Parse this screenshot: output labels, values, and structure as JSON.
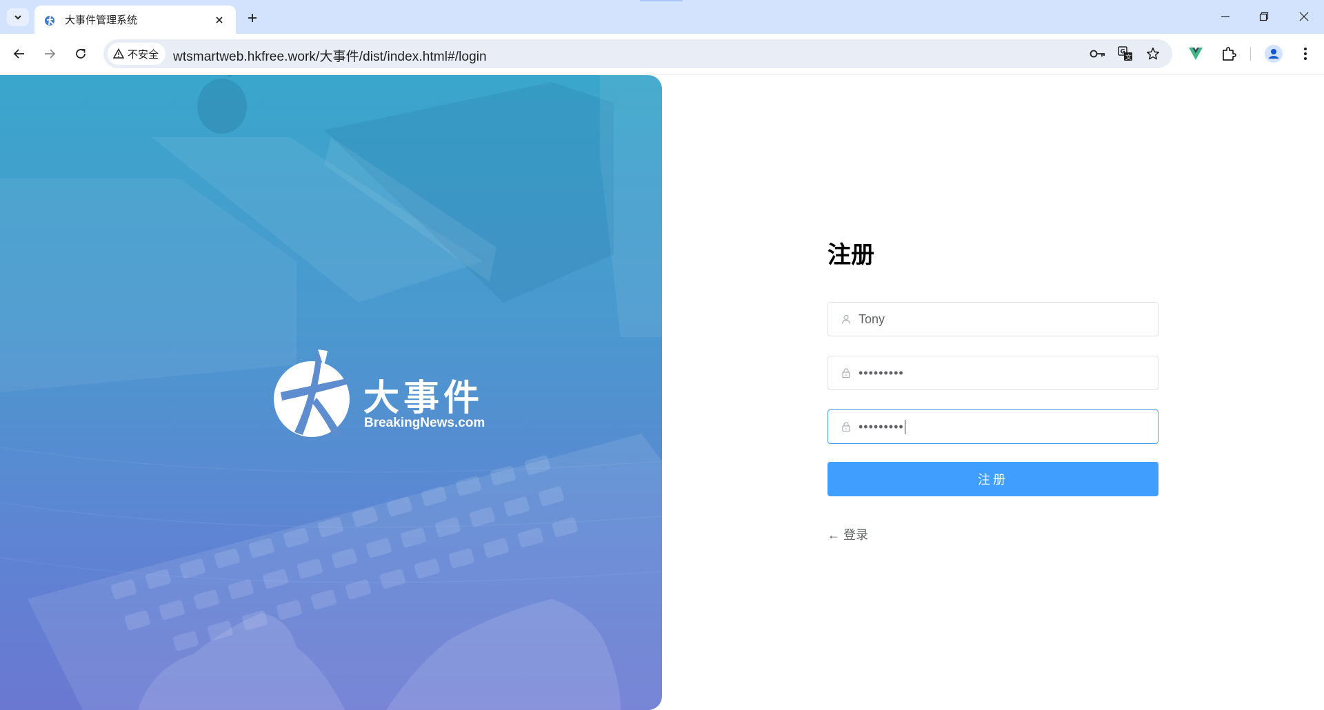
{
  "browser": {
    "tab_title": "大事件管理系统",
    "security_label": "不安全",
    "url": "wtsmartweb.hkfree.work/大事件/dist/index.html#/login"
  },
  "colors": {
    "primary": "#409eff",
    "hero_top": "#3aa6cb",
    "hero_bottom": "#6a78d2",
    "tabbar": "#d3e3fd"
  },
  "icons": {
    "tab_search": "chevron-down-icon",
    "favicon": "logo-icon",
    "close": "close-icon",
    "new_tab": "plus-icon",
    "back": "arrow-left-icon",
    "forward": "arrow-right-icon",
    "reload": "reload-icon",
    "warning": "warning-icon",
    "password_manager": "key-icon",
    "translate": "translate-icon",
    "bookmark": "star-icon",
    "vue_devtools": "vue-icon",
    "extensions": "puzzle-icon",
    "profile": "person-icon",
    "menu": "kebab-icon",
    "user": "user-icon",
    "lock": "lock-icon"
  },
  "brand": {
    "name": "大事件",
    "domain": "BreakingNews.com"
  },
  "register_form": {
    "title": "注册",
    "username_value": "Tony",
    "password_value": "•••••••••",
    "repassword_value": "•••••••••",
    "submit_label": "注册",
    "back_label": "← 登录"
  }
}
